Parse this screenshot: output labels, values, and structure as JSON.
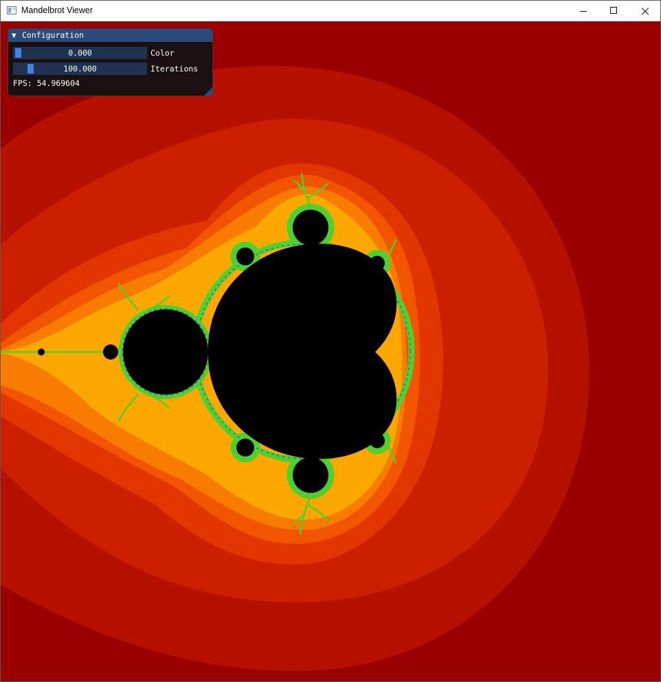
{
  "window": {
    "title": "Mandelbrot Viewer",
    "icon": "app-window-icon",
    "controls": [
      "minimize-icon",
      "maximize-icon",
      "close-icon"
    ]
  },
  "config_panel": {
    "title": "Configuration",
    "collapse_icon": "triangle-down-icon",
    "sliders": [
      {
        "label": "Color",
        "value": "0.000",
        "position_fraction": 0.0
      },
      {
        "label": "Iterations",
        "value": "100.000",
        "position_fraction": 0.1
      }
    ],
    "fps_text": "FPS: 54.969604"
  },
  "fractal": {
    "type": "mandelbrot",
    "colors": {
      "background": "#9b0000",
      "bands": [
        "#b61000",
        "#cc1f00",
        "#e23500",
        "#f25400",
        "#f97b00",
        "#fca800"
      ],
      "set": "#000000",
      "edge": "#4cd12e",
      "edge_accent": "#4a4ad8"
    }
  },
  "theme": {
    "panel_header": "#294a7a",
    "slider_frame": "#1f3350",
    "slider_grab": "#3d85e0"
  }
}
